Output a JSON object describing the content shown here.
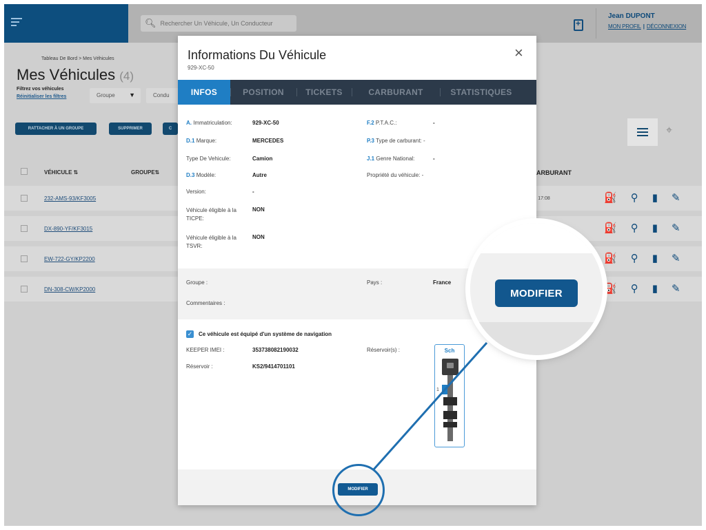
{
  "topbar": {
    "search_placeholder": "Rechercher Un Véhicule, Un Conducteur",
    "user_name": "Jean DUPONT",
    "profile_link": "MON PROFIL",
    "logout_link": "DÉCONNEXION",
    "separator": "|"
  },
  "page": {
    "breadcrumb": "Tableau De Bord > Mes Véhicules",
    "title": "Mes Véhicules",
    "count": "(4)",
    "filter_label": "Filtrez vos véhicules",
    "reset_filters": "Réinitialiser les filtres",
    "filter_groupe": "Groupe",
    "filter_conducteur": "Condu",
    "btn_attach": "RATTACHER À UN GROUPE",
    "btn_delete": "SUPPRIMER",
    "btn_partial": "C"
  },
  "table": {
    "col_vehicule": "VÉHICULE ⇅",
    "col_groupe": "GROUPE⇅",
    "col_carburant": "ARBURANT",
    "rows": [
      {
        "plate": "232-AMS-93/KF3005",
        "time": "- 17:08"
      },
      {
        "plate": "DX-890-YF/KF3015",
        "time": ""
      },
      {
        "plate": "EW-722-GY/KP2200",
        "time": ""
      },
      {
        "plate": "DN-308-CW/KP2000",
        "time": ""
      }
    ]
  },
  "modal": {
    "title": "Informations Du Véhicule",
    "subtitle": "929-XC-50",
    "close": "×",
    "tabs": [
      "INFOS",
      "POSITION",
      "TICKETS",
      "CARBURANT",
      "STATISTIQUES"
    ],
    "left_fields": {
      "immat": {
        "code": "A.",
        "label": "Immatriculation:",
        "value": "929-XC-50"
      },
      "marque": {
        "code": "D.1",
        "label": "Marque:",
        "value": "MERCEDES"
      },
      "type": {
        "label": "Type De Vehicule:",
        "value": "Camion"
      },
      "modele": {
        "code": "D.3",
        "label": "Modèle:",
        "value": "Autre"
      },
      "version": {
        "label": "Version:",
        "value": "-"
      },
      "ticpe": {
        "label1": "Véhicule éligible à la",
        "label2": "TICPE:",
        "value": "NON"
      },
      "tsvr": {
        "label1": "Véhicule éligible à la",
        "label2": "TSVR:",
        "value": "NON"
      }
    },
    "right_fields": {
      "ptac": {
        "code": "F.2",
        "label": "P.T.A.C.:",
        "value": "-"
      },
      "carburant": {
        "code": "P.3",
        "label": "Type de carburant:",
        "value": "-"
      },
      "genre": {
        "code": "J.1",
        "label": "Genre National:",
        "value": "-"
      },
      "propriete": {
        "label": "Propriété du véhicule:",
        "value": "-"
      }
    },
    "groupe_label": "Groupe :",
    "pays_label": "Pays :",
    "pays_value": "France",
    "commentaires_label": "Commentaires :",
    "nav_label": "Ce véhicule est équipé d'un système de navigation",
    "keeper_label": "KEEPER IMEI :",
    "keeper_value": "353738082190032",
    "reservoir_label": "Réservoir :",
    "reservoir_value": "KS2/9414701101",
    "reservoirs_label": "Réservoir(s) :",
    "tank_label": "Sch",
    "tank_num": "1",
    "modifier": "MODIFIER"
  },
  "callout": {
    "modifier": "MODIFIER"
  }
}
